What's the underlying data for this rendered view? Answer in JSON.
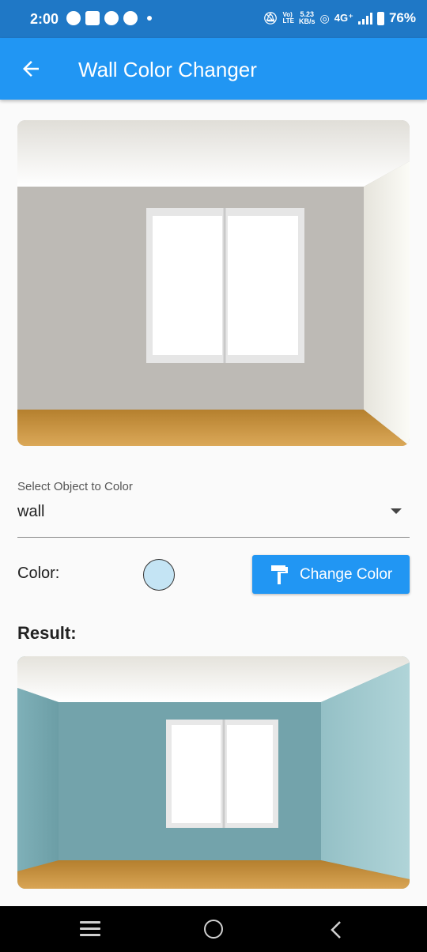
{
  "status_bar": {
    "time": "2:00",
    "speed": "5.23",
    "speed_unit": "KB/s",
    "network": "4G⁺",
    "volte": "Vo)\nLTE",
    "battery": "76%"
  },
  "app_bar": {
    "title": "Wall Color Changer"
  },
  "selector": {
    "label": "Select Object to Color",
    "value": "wall"
  },
  "color_row": {
    "label": "Color:",
    "selected_color": "#c4e4f4",
    "button_label": "Change Color"
  },
  "result": {
    "title": "Result:"
  },
  "colors": {
    "primary": "#2196f3",
    "status_bar": "#1f78c6",
    "original_wall": "#bdbab5",
    "result_wall": "#73a3ab"
  }
}
